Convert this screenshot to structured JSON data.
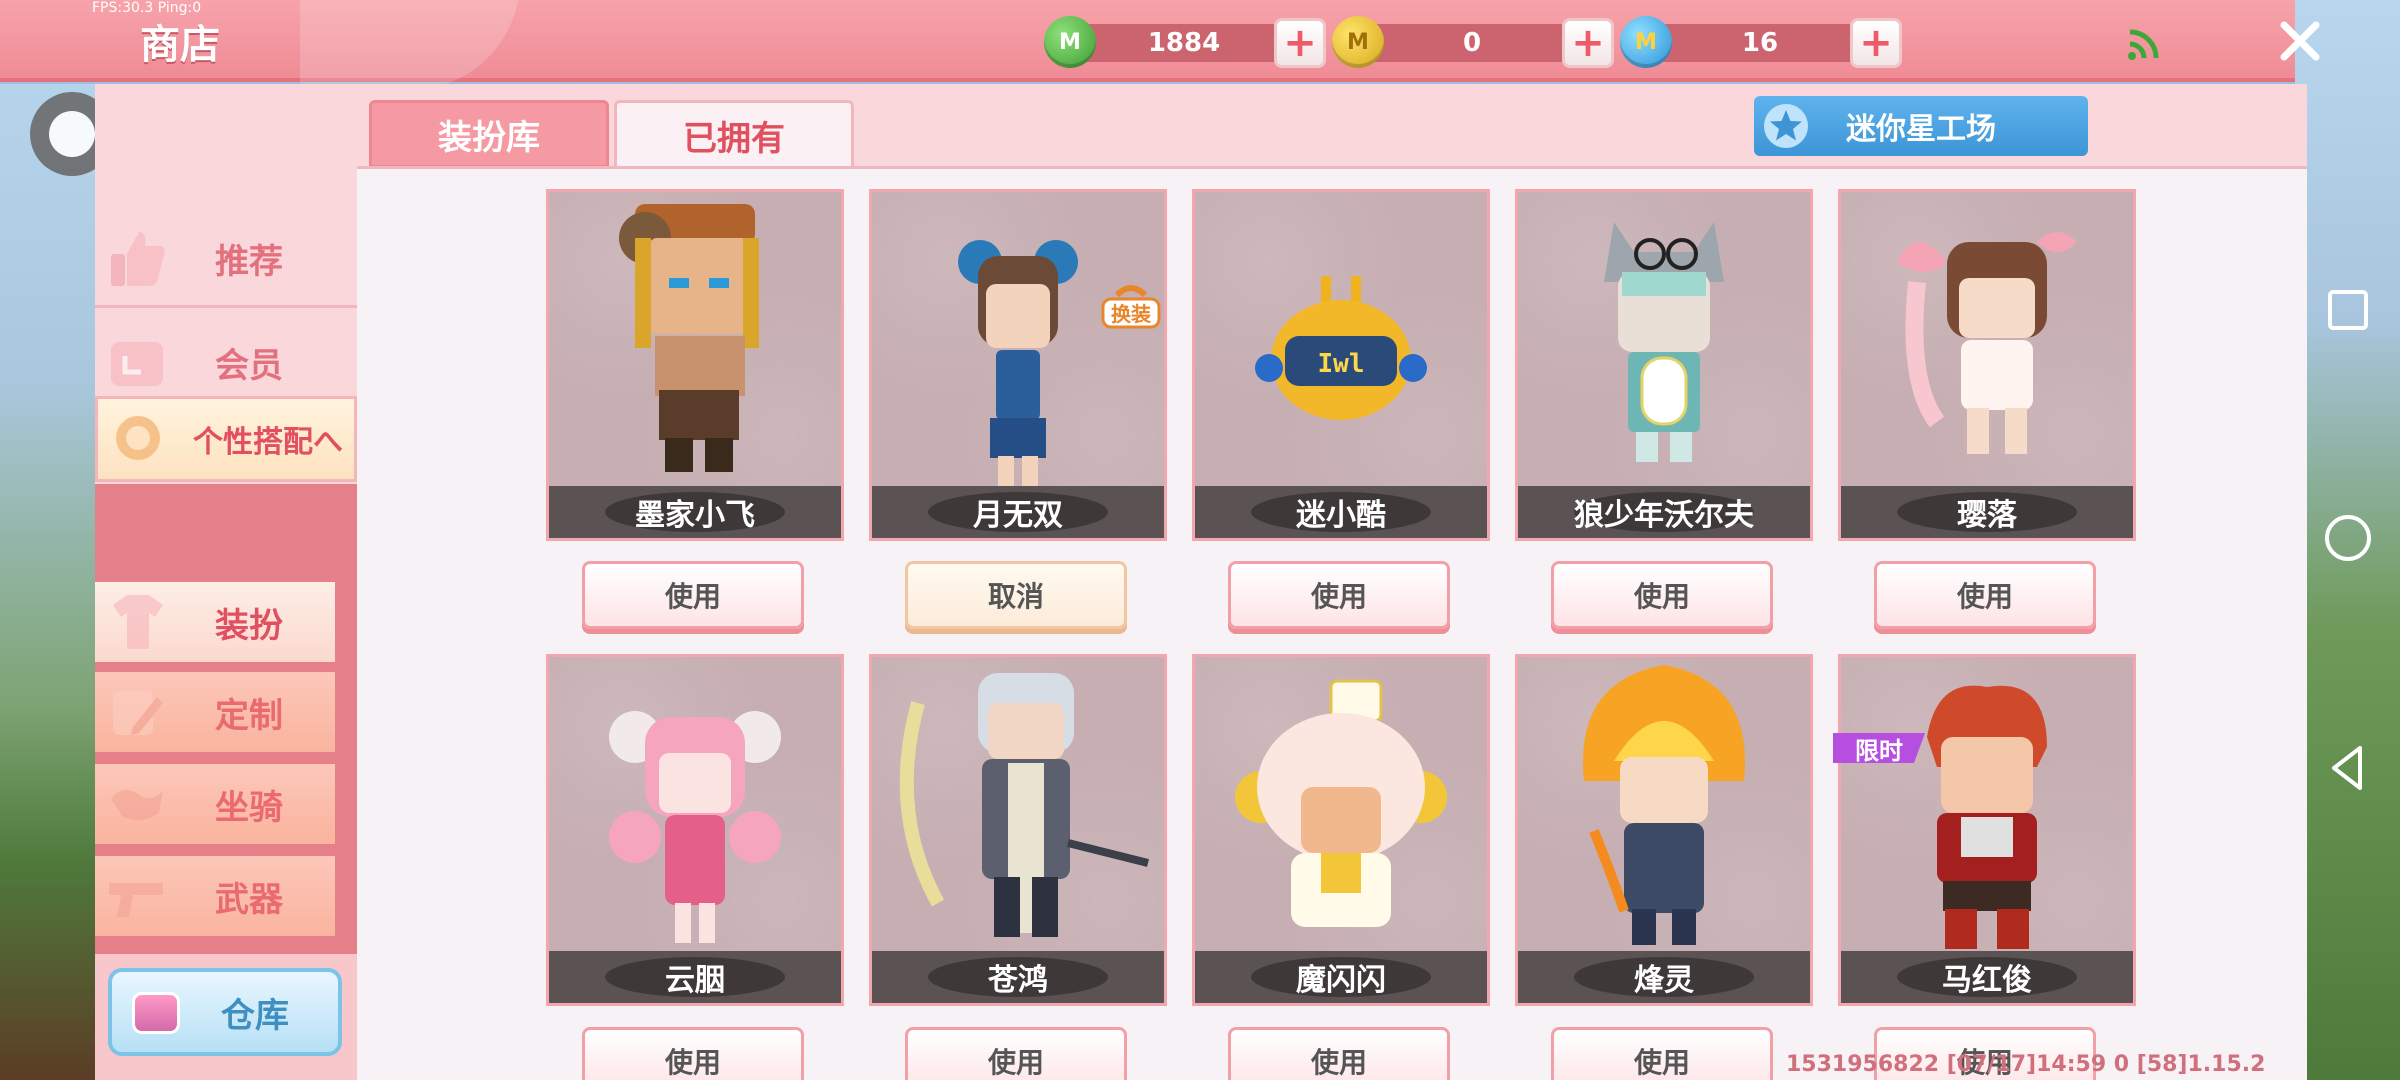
{
  "status": {
    "fps": "FPS:30.3 Ping:0"
  },
  "header": {
    "title": "商店",
    "currencies": [
      {
        "icon": "green-m-coin-icon",
        "value": "1884",
        "color": "#3a9a30"
      },
      {
        "icon": "gold-m-coin-icon",
        "value": "0",
        "color": "#d6a51a"
      },
      {
        "icon": "blue-m-coin-icon",
        "value": "16",
        "color": "#2a8fd6"
      }
    ],
    "plus_label": "+"
  },
  "sidebar": {
    "items": [
      {
        "label": "推荐",
        "icon": "thumbs-up-icon"
      },
      {
        "label": "会员",
        "icon": "vip-card-icon"
      },
      {
        "label": "个性搭配へ",
        "icon": "outfit-icon"
      }
    ],
    "subitems": [
      {
        "label": "装扮",
        "icon": "shirt-icon"
      },
      {
        "label": "定制",
        "icon": "pencil-icon"
      },
      {
        "label": "坐骑",
        "icon": "saddle-icon"
      },
      {
        "label": "武器",
        "icon": "gun-icon"
      }
    ],
    "warehouse_label": "仓库"
  },
  "tabs": [
    {
      "label": "装扮库",
      "active": false
    },
    {
      "label": "已拥有",
      "active": true
    }
  ],
  "workshop_label": "迷你星工场",
  "cards": [
    {
      "name": "墨家小飞",
      "button": "使用"
    },
    {
      "name": "月无双",
      "button": "取消",
      "badge": "换装"
    },
    {
      "name": "迷小酷",
      "button": "使用"
    },
    {
      "name": "狼少年沃尔夫",
      "button": "使用"
    },
    {
      "name": "璎落",
      "button": "使用"
    },
    {
      "name": "云胭",
      "button": "使用"
    },
    {
      "name": "苍鸿",
      "button": "使用"
    },
    {
      "name": "魔闪闪",
      "button": "使用"
    },
    {
      "name": "烽灵",
      "button": "使用"
    },
    {
      "name": "马红俊",
      "button": "使用",
      "limited_badge": "限时"
    }
  ],
  "footer": {
    "info": "1531956822  [07/17]14:59 0  [58]1.15.2"
  },
  "colors": {
    "accent_pink": "#ef8c96",
    "button_text": "#555555",
    "workshop_blue": "#3d95d6",
    "limited_purple": "#b64fe0"
  }
}
